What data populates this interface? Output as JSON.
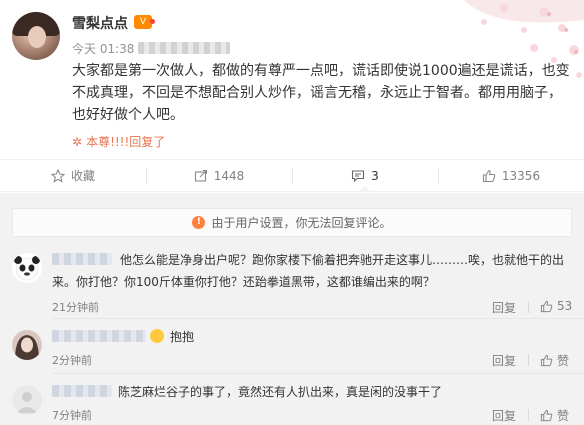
{
  "post": {
    "nickname": "雪梨点点",
    "vip_badge": "V",
    "time": "今天 01:38",
    "text": "大家都是第一次做人，都做的有尊严一点吧，谎话即使说1000遍还是谎话，也变不成真理，不回是不想配合别人炒作，谣言无稽，永远止于智者。都用用脑子，也好好做个人吧。",
    "reply_icon": "✲",
    "reply_text": "本尊!!!!回复了"
  },
  "actions": [
    {
      "icon": "star-icon",
      "label": "收藏"
    },
    {
      "icon": "share-icon",
      "label": "1448"
    },
    {
      "icon": "comment-icon",
      "label": "3"
    },
    {
      "icon": "thumbs-up-icon",
      "label": "13356"
    }
  ],
  "notice": {
    "icon": "!",
    "text": "由于用户设置，你无法回复评论。"
  },
  "comments": [
    {
      "text_line1": "他怎么能是净身出户呢？跑你家楼下偷着把奔驰开走这事儿………唉，也就他干的出",
      "text_line2": "来。你打他？你100斤体重你打他？还跆拳道黑带，这都谁编出来的啊？",
      "time": "21分钟前",
      "reply": "回复",
      "likes": "53"
    },
    {
      "text": "抱抱",
      "time": "2分钟前",
      "reply": "回复",
      "likes": "赞"
    },
    {
      "text": "陈芝麻烂谷子的事了，竟然还有人扒出来，真是闲的没事干了",
      "time": "7分钟前",
      "reply": "回复",
      "likes": "赞"
    }
  ],
  "colors": {
    "accent": "#eb7350",
    "vip": "#ff8a00",
    "notice_icon": "#ff8140"
  }
}
